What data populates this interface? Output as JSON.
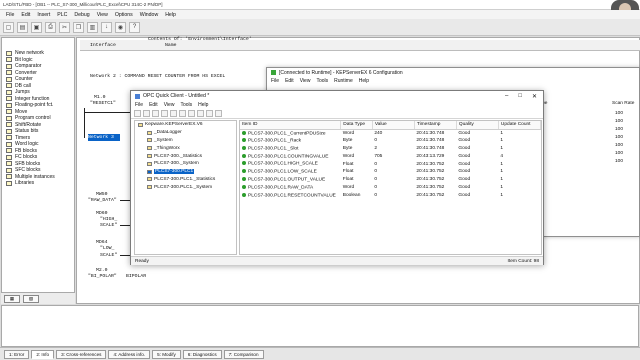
{
  "window_title": "LAD/STL/FBD - [OB1 -- PLC_S7-300_Millicour\\PLC_Excel\\CPU 314C-2 PN/DP]",
  "menu": [
    "File",
    "Edit",
    "Insert",
    "PLC",
    "Debug",
    "View",
    "Options",
    "Window",
    "Help"
  ],
  "left_tree": [
    "New network",
    "Bit logic",
    "Comparator",
    "Converter",
    "Counter",
    "DB call",
    "Jumps",
    "Integer function",
    "Floating-point fct.",
    "Move",
    "Program control",
    "Shift/Rotate",
    "Status bits",
    "Timers",
    "Word logic",
    "FB blocks",
    "FC blocks",
    "SFB blocks",
    "SFC blocks",
    "Multiple instances",
    "Libraries"
  ],
  "editor": {
    "contents_of": "Contents Of: 'Environment\\Interface'",
    "interface_label": "Interface",
    "name_col": "Name",
    "network_title": "Network 2 : COMMAND RESET COUNTER FROM HS EXCEL",
    "m_addr": "M1.0",
    "m_tag": "\"RESETC1\"",
    "network3": "Network 3",
    "mw50": "MW50",
    "raw_data": "\"RAW_DATA\"",
    "md60": "MD60",
    "high_scale": "\"HIGH_",
    "high_scale2": "SCALE\"",
    "md64": "MD64",
    "low_scale": "\"LOW_",
    "low_scale2": "SCALE\"",
    "m20": "M2.0",
    "bipolar": "\"BI_POLAR\"",
    "bipolar2": "BIPOLAR"
  },
  "config_window": {
    "title": "[Connected to Runtime] - KEPServerEX 6 Configuration",
    "menu": [
      "File",
      "Edit",
      "View",
      "Tools",
      "Runtime",
      "Help"
    ],
    "col_type": "Type",
    "col_scan": "Scan Rate",
    "scan_values": [
      "100",
      "100",
      "100",
      "100",
      "100",
      "100",
      "100"
    ]
  },
  "opc_window": {
    "title": "OPC Quick Client - Untitled *",
    "menu": [
      "File",
      "Edit",
      "View",
      "Tools",
      "Help"
    ],
    "tree": [
      "Kepware.KEPServerEX.V6",
      "_DataLogger",
      "_System",
      "_ThingWorx",
      "PLCS7-300._Statistics",
      "PLCS7-300._System",
      "PLCS7-300.PLC1",
      "PLCS7-300.PLC1._Statistics",
      "PLCS7-300.PLC1._System"
    ],
    "selected_tree_index": 6,
    "columns": [
      "Item ID",
      "Data Type",
      "Value",
      "Timestamp",
      "Quality",
      "Update Count"
    ],
    "rows": [
      [
        "PLCS7-300.PLC1._CurrentPDUSize",
        "Word",
        "240",
        "20:41:30.748",
        "Good",
        "1"
      ],
      [
        "PLCS7-300.PLC1._Rack",
        "Byte",
        "0",
        "20:41:30.748",
        "Good",
        "1"
      ],
      [
        "PLCS7-300.PLC1._Slot",
        "Byte",
        "2",
        "20:41:30.748",
        "Good",
        "1"
      ],
      [
        "PLCS7-300.PLC1.COUNTINGVALUE",
        "Word",
        "705",
        "20:43:13.729",
        "Good",
        "4"
      ],
      [
        "PLCS7-300.PLC1.HIGH_SCALE",
        "Float",
        "0",
        "20:41:30.752",
        "Good",
        "1"
      ],
      [
        "PLCS7-300.PLC1.LOW_SCALE",
        "Float",
        "0",
        "20:41:30.752",
        "Good",
        "1"
      ],
      [
        "PLCS7-300.PLC1.OUTPUT_VALUE",
        "Float",
        "0",
        "20:41:30.752",
        "Good",
        "1"
      ],
      [
        "PLCS7-300.PLC1.RAW_DATA",
        "Word",
        "0",
        "20:41:30.752",
        "Good",
        "1"
      ],
      [
        "PLCS7-300.PLC1.RESETCOUNTVALUE",
        "Boolean",
        "0",
        "20:41:30.752",
        "Good",
        "1"
      ]
    ],
    "status_left": "Ready",
    "status_right": "Item Count: 98"
  },
  "bottom_tabs": [
    "1: Error",
    "2: Info",
    "3: Cross-references",
    "4: Address info.",
    "5: Modify",
    "6: Diagnostics",
    "7: Comparison"
  ],
  "active_bottom_tab": 1,
  "colors": {
    "selection": "#0a63c7",
    "good_dot": "#2c9d2c",
    "network_highlight": "#0a63c7"
  }
}
